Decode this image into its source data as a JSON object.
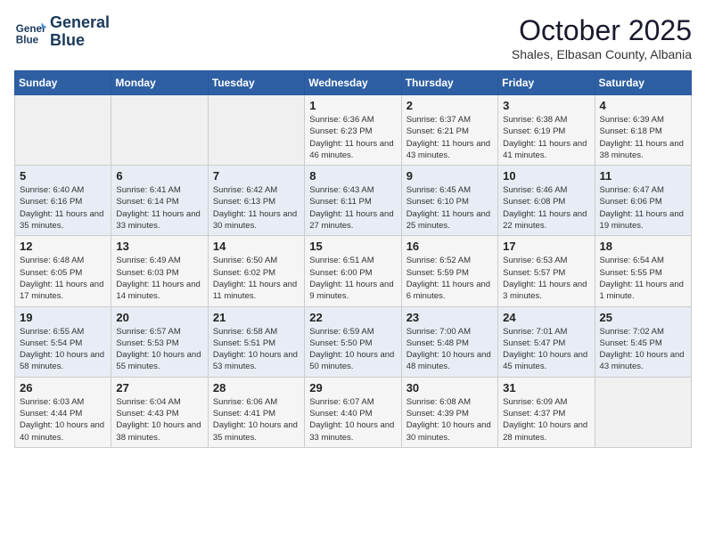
{
  "logo": {
    "line1": "General",
    "line2": "Blue"
  },
  "title": "October 2025",
  "subtitle": "Shales, Elbasan County, Albania",
  "weekdays": [
    "Sunday",
    "Monday",
    "Tuesday",
    "Wednesday",
    "Thursday",
    "Friday",
    "Saturday"
  ],
  "weeks": [
    [
      {
        "day": "",
        "info": ""
      },
      {
        "day": "",
        "info": ""
      },
      {
        "day": "",
        "info": ""
      },
      {
        "day": "1",
        "info": "Sunrise: 6:36 AM\nSunset: 6:23 PM\nDaylight: 11 hours and 46 minutes."
      },
      {
        "day": "2",
        "info": "Sunrise: 6:37 AM\nSunset: 6:21 PM\nDaylight: 11 hours and 43 minutes."
      },
      {
        "day": "3",
        "info": "Sunrise: 6:38 AM\nSunset: 6:19 PM\nDaylight: 11 hours and 41 minutes."
      },
      {
        "day": "4",
        "info": "Sunrise: 6:39 AM\nSunset: 6:18 PM\nDaylight: 11 hours and 38 minutes."
      }
    ],
    [
      {
        "day": "5",
        "info": "Sunrise: 6:40 AM\nSunset: 6:16 PM\nDaylight: 11 hours and 35 minutes."
      },
      {
        "day": "6",
        "info": "Sunrise: 6:41 AM\nSunset: 6:14 PM\nDaylight: 11 hours and 33 minutes."
      },
      {
        "day": "7",
        "info": "Sunrise: 6:42 AM\nSunset: 6:13 PM\nDaylight: 11 hours and 30 minutes."
      },
      {
        "day": "8",
        "info": "Sunrise: 6:43 AM\nSunset: 6:11 PM\nDaylight: 11 hours and 27 minutes."
      },
      {
        "day": "9",
        "info": "Sunrise: 6:45 AM\nSunset: 6:10 PM\nDaylight: 11 hours and 25 minutes."
      },
      {
        "day": "10",
        "info": "Sunrise: 6:46 AM\nSunset: 6:08 PM\nDaylight: 11 hours and 22 minutes."
      },
      {
        "day": "11",
        "info": "Sunrise: 6:47 AM\nSunset: 6:06 PM\nDaylight: 11 hours and 19 minutes."
      }
    ],
    [
      {
        "day": "12",
        "info": "Sunrise: 6:48 AM\nSunset: 6:05 PM\nDaylight: 11 hours and 17 minutes."
      },
      {
        "day": "13",
        "info": "Sunrise: 6:49 AM\nSunset: 6:03 PM\nDaylight: 11 hours and 14 minutes."
      },
      {
        "day": "14",
        "info": "Sunrise: 6:50 AM\nSunset: 6:02 PM\nDaylight: 11 hours and 11 minutes."
      },
      {
        "day": "15",
        "info": "Sunrise: 6:51 AM\nSunset: 6:00 PM\nDaylight: 11 hours and 9 minutes."
      },
      {
        "day": "16",
        "info": "Sunrise: 6:52 AM\nSunset: 5:59 PM\nDaylight: 11 hours and 6 minutes."
      },
      {
        "day": "17",
        "info": "Sunrise: 6:53 AM\nSunset: 5:57 PM\nDaylight: 11 hours and 3 minutes."
      },
      {
        "day": "18",
        "info": "Sunrise: 6:54 AM\nSunset: 5:55 PM\nDaylight: 11 hours and 1 minute."
      }
    ],
    [
      {
        "day": "19",
        "info": "Sunrise: 6:55 AM\nSunset: 5:54 PM\nDaylight: 10 hours and 58 minutes."
      },
      {
        "day": "20",
        "info": "Sunrise: 6:57 AM\nSunset: 5:53 PM\nDaylight: 10 hours and 55 minutes."
      },
      {
        "day": "21",
        "info": "Sunrise: 6:58 AM\nSunset: 5:51 PM\nDaylight: 10 hours and 53 minutes."
      },
      {
        "day": "22",
        "info": "Sunrise: 6:59 AM\nSunset: 5:50 PM\nDaylight: 10 hours and 50 minutes."
      },
      {
        "day": "23",
        "info": "Sunrise: 7:00 AM\nSunset: 5:48 PM\nDaylight: 10 hours and 48 minutes."
      },
      {
        "day": "24",
        "info": "Sunrise: 7:01 AM\nSunset: 5:47 PM\nDaylight: 10 hours and 45 minutes."
      },
      {
        "day": "25",
        "info": "Sunrise: 7:02 AM\nSunset: 5:45 PM\nDaylight: 10 hours and 43 minutes."
      }
    ],
    [
      {
        "day": "26",
        "info": "Sunrise: 6:03 AM\nSunset: 4:44 PM\nDaylight: 10 hours and 40 minutes."
      },
      {
        "day": "27",
        "info": "Sunrise: 6:04 AM\nSunset: 4:43 PM\nDaylight: 10 hours and 38 minutes."
      },
      {
        "day": "28",
        "info": "Sunrise: 6:06 AM\nSunset: 4:41 PM\nDaylight: 10 hours and 35 minutes."
      },
      {
        "day": "29",
        "info": "Sunrise: 6:07 AM\nSunset: 4:40 PM\nDaylight: 10 hours and 33 minutes."
      },
      {
        "day": "30",
        "info": "Sunrise: 6:08 AM\nSunset: 4:39 PM\nDaylight: 10 hours and 30 minutes."
      },
      {
        "day": "31",
        "info": "Sunrise: 6:09 AM\nSunset: 4:37 PM\nDaylight: 10 hours and 28 minutes."
      },
      {
        "day": "",
        "info": ""
      }
    ]
  ]
}
